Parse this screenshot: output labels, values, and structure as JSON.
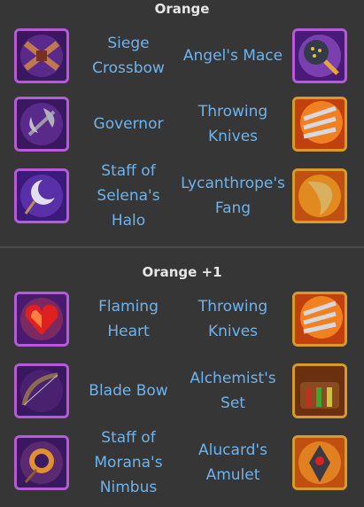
{
  "sections": [
    {
      "title": "Orange",
      "rows": [
        {
          "left": {
            "name": "Siege Crossbow",
            "icon": "siege-crossbow-icon",
            "frame": "purple"
          },
          "right": {
            "name": "Angel's Mace",
            "icon": "angels-mace-icon",
            "frame": "purple"
          }
        },
        {
          "left": {
            "name": "Governor",
            "icon": "governor-axe-icon",
            "frame": "purple"
          },
          "right": {
            "name": "Throwing Knives",
            "icon": "throwing-knives-icon",
            "frame": "gold"
          }
        },
        {
          "left": {
            "name": "Staff of Selena's Halo",
            "icon": "staff-of-selenas-halo-icon",
            "frame": "purple"
          },
          "right": {
            "name": "Lycanthrope's Fang",
            "icon": "lycanthropes-fang-icon",
            "frame": "gold"
          }
        }
      ]
    },
    {
      "title": "Orange +1",
      "rows": [
        {
          "left": {
            "name": "Flaming Heart",
            "icon": "flaming-heart-icon",
            "frame": "purple"
          },
          "right": {
            "name": "Throwing Knives",
            "icon": "throwing-knives-icon",
            "frame": "gold"
          }
        },
        {
          "left": {
            "name": "Blade Bow",
            "icon": "blade-bow-icon",
            "frame": "purple"
          },
          "right": {
            "name": "Alchemist's Set",
            "icon": "alchemists-set-icon",
            "frame": "gold"
          }
        },
        {
          "left": {
            "name": "Staff of Morana's Nimbus",
            "icon": "staff-of-moranas-nimbus-icon",
            "frame": "purple"
          },
          "right": {
            "name": "Alucard's Amulet",
            "icon": "alucards-amulet-icon",
            "frame": "gold"
          }
        }
      ]
    }
  ],
  "colors": {
    "background": "#363636",
    "title": "#e6e6e6",
    "item_text": "#6fb3ec",
    "purple_frame": "#b65bd8",
    "gold_frame": "#d99a2a"
  }
}
